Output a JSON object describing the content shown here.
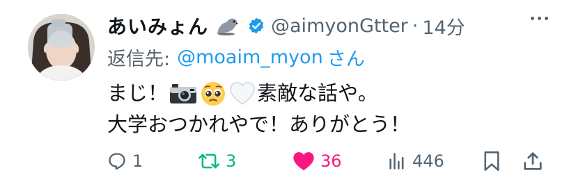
{
  "tweet": {
    "display_name": "あいみょん",
    "handle": "@aimyonGtter",
    "separator": "·",
    "time": "14分",
    "reply_prefix": "返信先:",
    "reply_to": "@moaim_myon",
    "reply_suffix": "さん",
    "line1_a": "まじ！",
    "line1_b": "素敵な話や。",
    "line2": "大学おつかれやで！ありがとう！",
    "emojis": [
      "seal-emoji",
      "camera-emoji",
      "pleading-face-emoji",
      "white-heart-emoji"
    ]
  },
  "actions": {
    "reply_count": "1",
    "retweet_count": "3",
    "like_count": "36",
    "views_count": "446"
  },
  "colors": {
    "accent": "#1d9bf0",
    "muted": "#536471",
    "retweet": "#00ba7c",
    "like": "#f91880"
  }
}
